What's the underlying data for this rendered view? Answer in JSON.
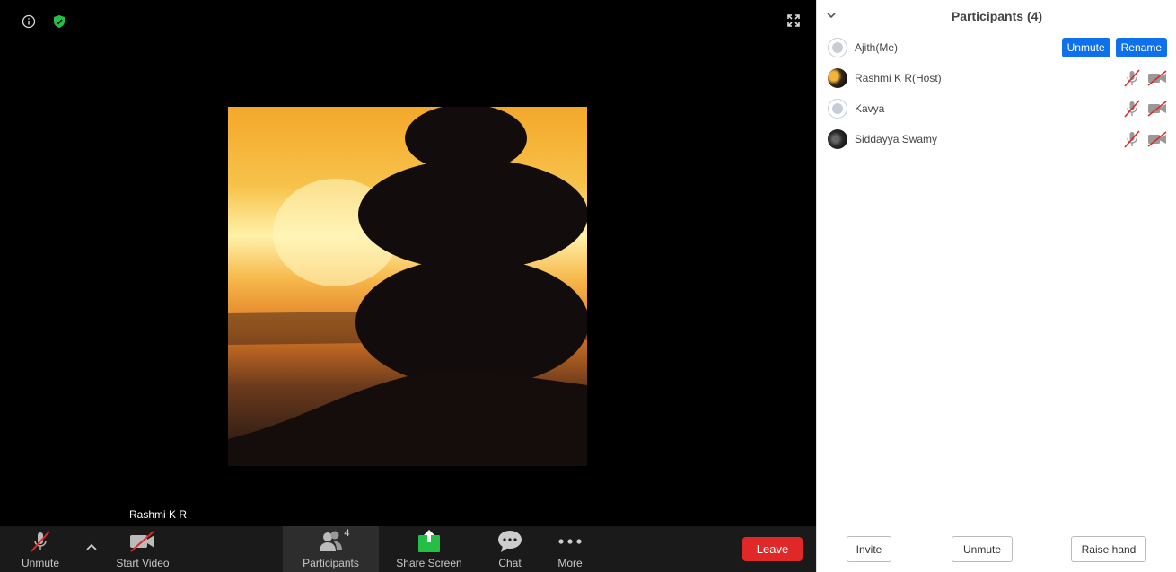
{
  "panel": {
    "title": "Participants (4)",
    "participants": [
      {
        "name": "Ajith(Me)",
        "avatar": "default",
        "actions": {
          "unmute": "Unmute",
          "rename": "Rename"
        }
      },
      {
        "name": "Rashmi K R(Host)",
        "avatar": "photo-sunset"
      },
      {
        "name": "Kavya",
        "avatar": "default"
      },
      {
        "name": "Siddayya Swamy",
        "avatar": "photo-dark"
      }
    ],
    "buttons": {
      "invite": "Invite",
      "unmute": "Unmute",
      "raise_hand": "Raise hand"
    }
  },
  "video": {
    "speaker_name": "Rashmi K R"
  },
  "toolbar": {
    "unmute_label": "Unmute",
    "video_label": "Start Video",
    "participants_label": "Participants",
    "participants_count": "4",
    "share_label": "Share Screen",
    "chat_label": "Chat",
    "more_label": "More",
    "leave_label": "Leave"
  },
  "colors": {
    "accent": "#0e71eb",
    "leave": "#e02828",
    "share": "#23c045",
    "shield": "#23c045",
    "muted_slash": "#e02828"
  },
  "icons": [
    "info-icon",
    "shield-icon",
    "fullscreen-icon",
    "mic-muted-icon",
    "video-off-icon",
    "participants-icon",
    "share-screen-icon",
    "chat-icon",
    "more-icon",
    "chevron-down-icon",
    "chevron-up-icon"
  ]
}
